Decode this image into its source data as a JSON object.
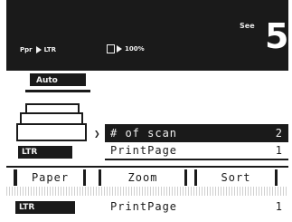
{
  "colors": {
    "panel": "#1a1a1a",
    "panel_text": "#f2f2f2",
    "screen_bg": "#ffffff"
  },
  "header": {
    "sup_label": "See",
    "copies": "5",
    "paper_label": "Ppr",
    "paper_value": "LTR",
    "zoom_value": "100%"
  },
  "mode": {
    "label": "Auto"
  },
  "paper_indicator": {
    "top_size": "LTR",
    "bottom_size": "LTR"
  },
  "list": {
    "items": [
      {
        "label": "# of scan",
        "value": "2",
        "selected": true
      },
      {
        "label": "PrintPage",
        "value": "1",
        "selected": false
      }
    ],
    "cursor_icon": "arrow-right-icon",
    "repeat_item": {
      "label": "PrintPage",
      "value": "1"
    }
  },
  "softkeys": {
    "paper": "Paper",
    "zoom": "Zoom",
    "sort": "Sort"
  }
}
